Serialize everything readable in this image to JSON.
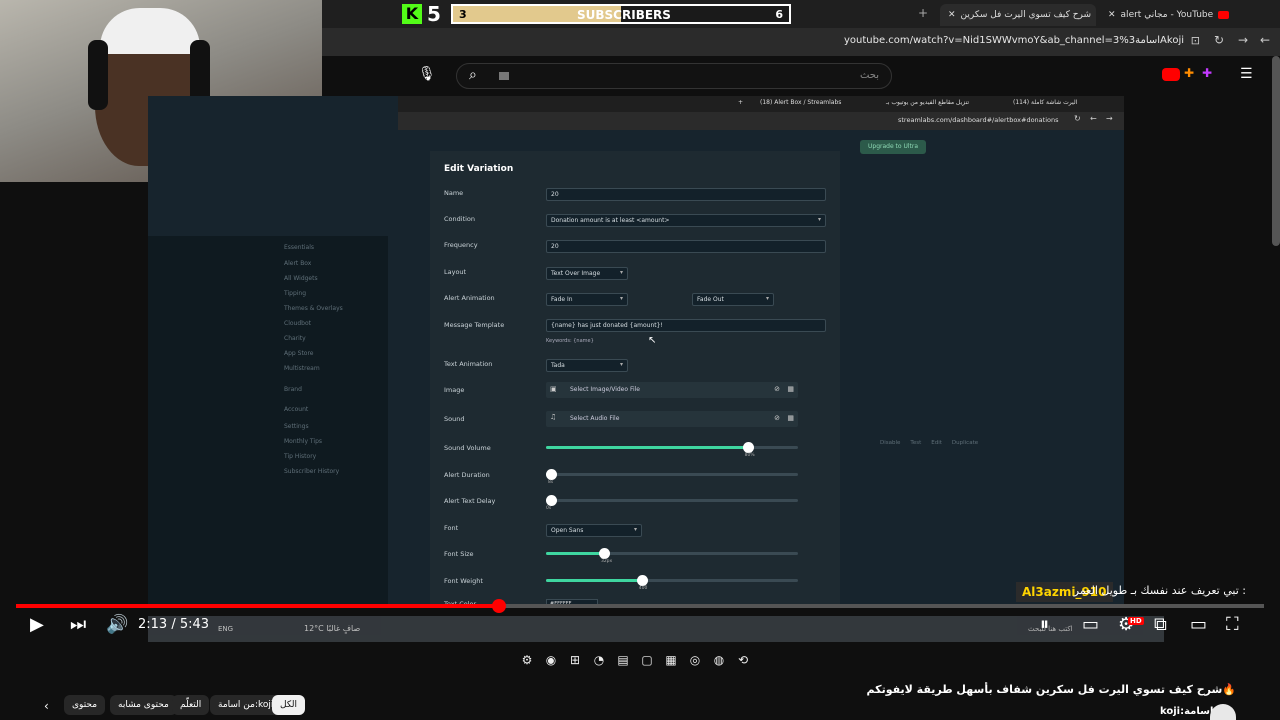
{
  "browser": {
    "tabs": [
      {
        "label": "alert مجاني - YouTube",
        "active": false
      },
      {
        "label": "شرح كيف تسوي اليرت فل سكرين",
        "active": true
      }
    ],
    "url": "youtube.com/watch?v=Nid1SWWvmoY&ab_channel=3%اسامة3Akoji"
  },
  "youtube": {
    "search_placeholder": "بحث"
  },
  "overlay": {
    "kick_count": "5",
    "sub_goal_label": "SUBSCRIBERS",
    "sub_goal_current": "3",
    "sub_goal_target": "6",
    "sub_goal_progress": 0.5
  },
  "inner_browser": {
    "tabs": [
      "(18) Alert Box / Streamlabs",
      "تنزيل مقاطع الفيديو من يوتيوب بـ",
      "(114) اليرت شاشة كاملة"
    ],
    "url": "streamlabs.com/dashboard#/alertbox#donations",
    "upgrade_label": "Upgrade to Ultra",
    "sidebar": {
      "section_essentials": "Essentials",
      "items": [
        "Alert Box",
        "All Widgets",
        "Tipping",
        "Themes & Overlays",
        "Cloudbot",
        "Charity",
        "App Store",
        "Multistream"
      ],
      "section_brand": "Brand",
      "section_account": "Account",
      "account_items": [
        "Settings",
        "Monthly Tips",
        "Tip History",
        "Subscriber History"
      ]
    },
    "table_actions": [
      "Disable",
      "Test",
      "Edit",
      "Duplicate"
    ]
  },
  "edit_variation": {
    "title": "Edit Variation",
    "name_label": "Name",
    "name_value": "20",
    "condition_label": "Condition",
    "condition_value": "Donation amount is at least <amount>",
    "frequency_label": "Frequency",
    "frequency_value": "20",
    "layout_label": "Layout",
    "layout_value": "Text Over Image",
    "alert_animation_label": "Alert Animation",
    "alert_in": "Fade In",
    "alert_out": "Fade Out",
    "message_template_label": "Message Template",
    "message_template_value": "{name} has just donated {amount}!",
    "keywords": "Keywords: {name}",
    "text_animation_label": "Text Animation",
    "text_animation_value": "Tada",
    "image_label": "Image",
    "image_placeholder": "Select Image/Video File",
    "sound_label": "Sound",
    "sound_placeholder": "Select Audio File",
    "sound_volume_label": "Sound Volume",
    "sound_volume_value": "80%",
    "sound_volume_level": 0.8,
    "alert_duration_label": "Alert Duration",
    "alert_duration_value": "8s",
    "alert_duration_level": 0.02,
    "alert_text_delay_label": "Alert Text Delay",
    "alert_text_delay_value": "0s",
    "alert_text_delay_level": 0,
    "font_label": "Font",
    "font_value": "Open Sans",
    "font_size_label": "Font Size",
    "font_size_value": "32px",
    "font_size_level": 0.23,
    "font_weight_label": "Font Weight",
    "font_weight_value": "400",
    "font_weight_level": 0.38,
    "text_color_label": "Text Color",
    "text_color_value": "#FFFFFF"
  },
  "player": {
    "time_current": "2:13",
    "time_total": "5:43",
    "progress": 0.387,
    "ticker_user": "Al3azmi_910",
    "ticker_text": "تبي تعريف عند نفسك بـ طويل العمر :",
    "hd_badge": "HD"
  },
  "taskbar": {
    "weather": "12°C  صافٍ غالبًا",
    "search": "اكتب هنا للبحث",
    "lang": "ENG"
  },
  "video_info": {
    "title": "شرح كيف تسوي اليرت فل سكرين شفاف بأسهل طريقة لايفوتكم🔥",
    "channel": "koji:اسامة",
    "chips": [
      "الكل",
      "من اسامة:koji",
      "التعلّم",
      "محتوى مشابه",
      "محتوى"
    ]
  },
  "colors": {
    "accent_red": "#ff0000",
    "slider_green": "#3fd6a0",
    "ticker_yellow": "#ffd400",
    "goal_fill": "#e2c98d"
  }
}
